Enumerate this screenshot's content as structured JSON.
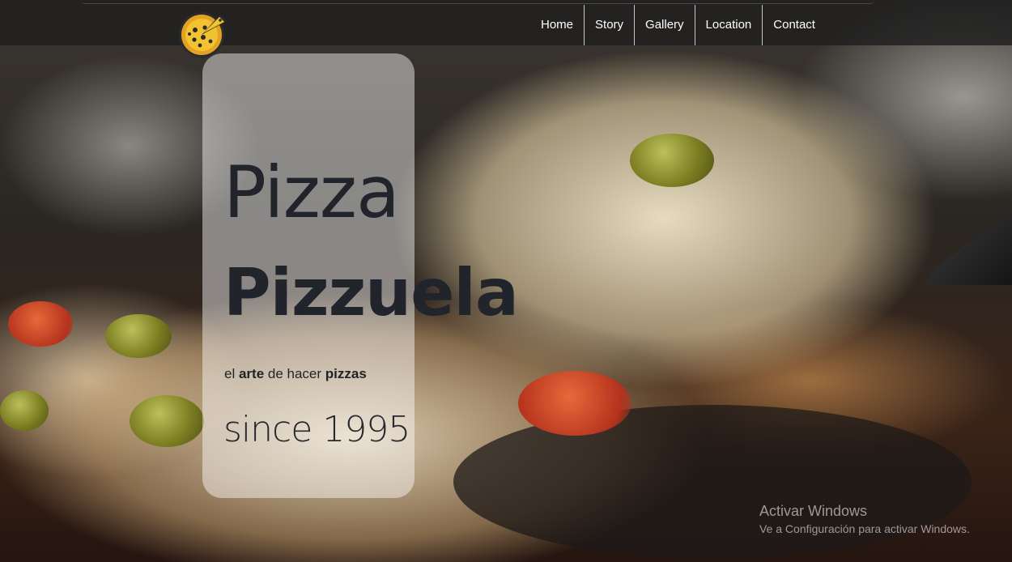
{
  "nav": {
    "links": [
      "Home",
      "Story",
      "Gallery",
      "Location",
      "Contact"
    ]
  },
  "logo": {
    "icon": "pizza-icon"
  },
  "hero": {
    "title_line1": "Pizza",
    "title_line2": "Pizzuela",
    "tagline": {
      "part1": "el ",
      "bold1": "arte",
      "part2": " de hacer ",
      "bold2": "pizzas"
    },
    "since": "since 1995"
  },
  "watermark": {
    "title": "Activar Windows",
    "subtitle": "Ve a Configuración para activar Windows."
  },
  "colors": {
    "navbar": "#1e1e1e",
    "title_text": "#21252b",
    "card_overlay": "rgba(255,255,255,0.45)"
  }
}
